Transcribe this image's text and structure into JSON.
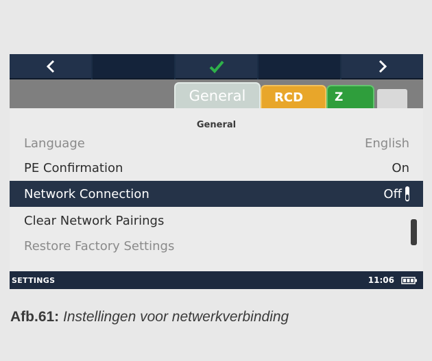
{
  "navbar": {
    "buttons": [
      {
        "icon": "chevron-left-icon"
      },
      {
        "icon": ""
      },
      {
        "icon": "checkmark-icon"
      },
      {
        "icon": ""
      },
      {
        "icon": "chevron-right-icon"
      }
    ],
    "check_color": "#2fb14a"
  },
  "tabs": [
    {
      "label": "General",
      "active": true,
      "color": "#c9d4cf"
    },
    {
      "label": "RCD",
      "active": false,
      "color": "#e8a62a"
    },
    {
      "label": "Z",
      "active": false,
      "color": "#2f9e3c"
    }
  ],
  "section_title": "General",
  "settings": [
    {
      "label": "Language",
      "value": "English",
      "state": "disabled"
    },
    {
      "label": "PE Confirmation",
      "value": "On",
      "state": "normal"
    },
    {
      "label": "Network Connection",
      "value": "Off",
      "state": "selected"
    },
    {
      "label": "Clear Network Pairings",
      "value": "",
      "state": "normal"
    },
    {
      "label": "Restore Factory Settings",
      "value": "",
      "state": "disabled"
    }
  ],
  "status": {
    "mode": "SETTINGS",
    "time": "11:06"
  },
  "caption": {
    "figure": "Afb.61:",
    "text": "Instellingen voor netwerkverbinding"
  }
}
